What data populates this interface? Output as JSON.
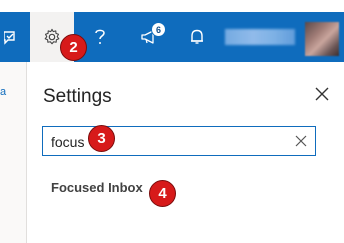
{
  "topbar": {
    "color": "#0f6cbd",
    "icons": [
      "feedback-icon",
      "gear-icon",
      "help-icon",
      "megaphone-icon",
      "bell-icon"
    ],
    "whats_new_count": "6"
  },
  "settings": {
    "title": "Settings",
    "search_value": "focus",
    "result": "Focused Inbox"
  },
  "left_strip": {
    "text": "a"
  },
  "steps": {
    "two": "2",
    "three": "3",
    "four": "4"
  }
}
